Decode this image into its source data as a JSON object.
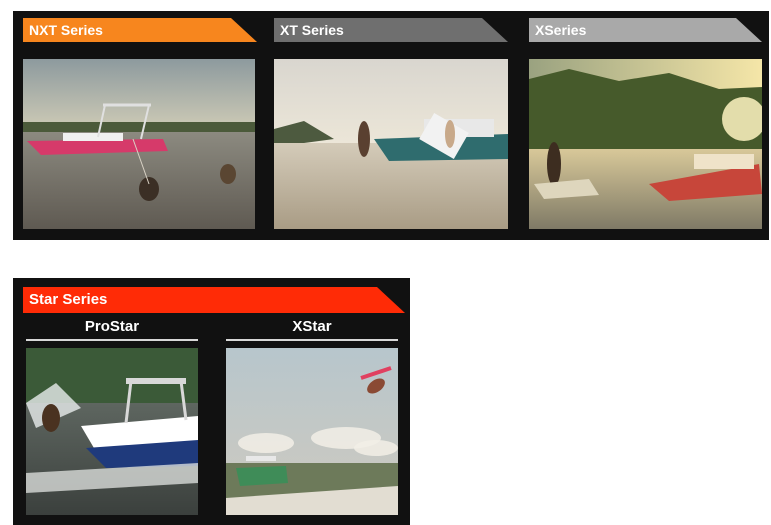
{
  "series": [
    {
      "label": "NXT Series",
      "color": "#f7861e",
      "photo": "nxt-boat-photo"
    },
    {
      "label": "XT Series",
      "color": "#6f6f6f",
      "photo": "xt-boat-photo"
    },
    {
      "label": "XSeries",
      "color": "#a9a9a9",
      "photo": "xseries-boat-photo"
    }
  ],
  "star_series": {
    "label": "Star Series",
    "color": "#ff2b06",
    "models": [
      {
        "label": "ProStar",
        "photo": "prostar-boat-photo"
      },
      {
        "label": "XStar",
        "photo": "xstar-boat-photo"
      }
    ]
  }
}
